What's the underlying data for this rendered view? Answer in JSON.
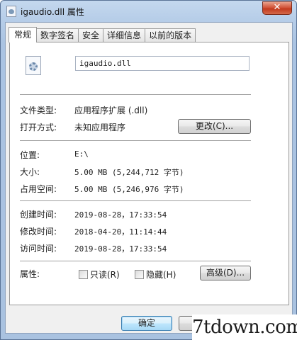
{
  "window": {
    "title": "igaudio.dll 属性",
    "close_glyph": "✕"
  },
  "tabs": [
    "常规",
    "数字签名",
    "安全",
    "详细信息",
    "以前的版本"
  ],
  "general": {
    "file_name": "igaudio.dll",
    "rows": {
      "file_type": {
        "label": "文件类型:",
        "value": "应用程序扩展 (.dll)"
      },
      "opens_with": {
        "label": "打开方式:",
        "value": "未知应用程序",
        "button": "更改(C)..."
      },
      "location": {
        "label": "位置:",
        "value": "E:\\"
      },
      "size": {
        "label": "大小:",
        "value": "5.00 MB (5,244,712 字节)"
      },
      "size_on_disk": {
        "label": "占用空间:",
        "value": "5.00 MB (5,246,976 字节)"
      },
      "created": {
        "label": "创建时间:",
        "value": "2019-08-28，17:33:54"
      },
      "modified": {
        "label": "修改时间:",
        "value": "2018-04-20，11:14:44"
      },
      "accessed": {
        "label": "访问时间:",
        "value": "2019-08-28，17:33:54"
      },
      "attributes": {
        "label": "属性:",
        "readonly": "只读(R)",
        "hidden": "隐藏(H)",
        "advanced": "高级(D)..."
      }
    }
  },
  "footer": {
    "ok": "确定"
  },
  "watermark": "7tdown.com"
}
